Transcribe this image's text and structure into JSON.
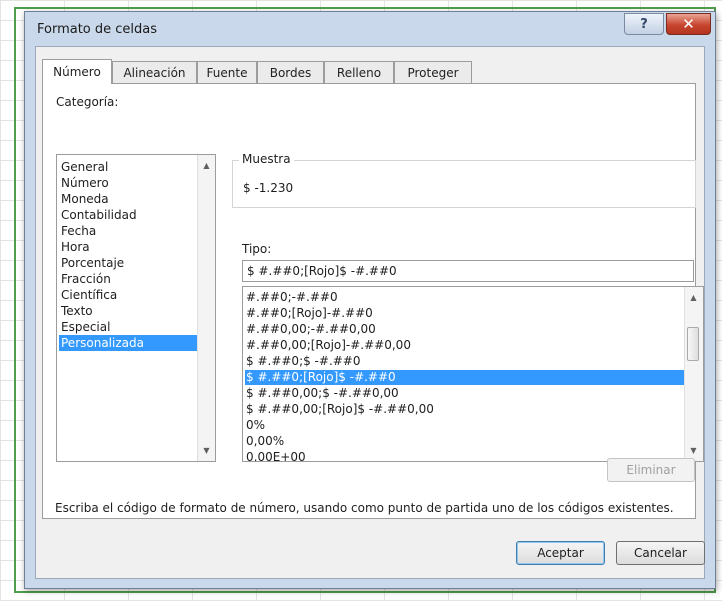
{
  "window": {
    "title": "Formato de celdas",
    "help_glyph": "?",
    "close_glyph": "✕"
  },
  "tabs": [
    "Número",
    "Alineación",
    "Fuente",
    "Bordes",
    "Relleno",
    "Proteger"
  ],
  "active_tab": "Número",
  "category": {
    "label": "Categoría:",
    "items": [
      "General",
      "Número",
      "Moneda",
      "Contabilidad",
      "Fecha",
      "Hora",
      "Porcentaje",
      "Fracción",
      "Científica",
      "Texto",
      "Especial",
      "Personalizada"
    ],
    "selected": "Personalizada"
  },
  "sample": {
    "legend": "Muestra",
    "value": "$ -1.230"
  },
  "type": {
    "label": "Tipo:",
    "value": "$ #.##0;[Rojo]$ -#.##0",
    "items": [
      "#.##0;-#.##0",
      "#.##0;[Rojo]-#.##0",
      "#.##0,00;-#.##0,00",
      "#.##0,00;[Rojo]-#.##0,00",
      "$ #.##0;$ -#.##0",
      "$ #.##0;[Rojo]$ -#.##0",
      "$ #.##0,00;$ -#.##0,00",
      "$ #.##0,00;[Rojo]$ -#.##0,00",
      "0%",
      "0,00%",
      "0,00E+00"
    ],
    "selected": "$ #.##0;[Rojo]$ -#.##0"
  },
  "buttons": {
    "delete": "Eliminar",
    "ok": "Aceptar",
    "cancel": "Cancelar"
  },
  "description": "Escriba el código de formato de número, usando como punto de partida uno de los códigos existentes.",
  "colors": {
    "selection": "#3399ff",
    "frame_accent": "#4f9e4a",
    "close_button": "#c8462f"
  }
}
